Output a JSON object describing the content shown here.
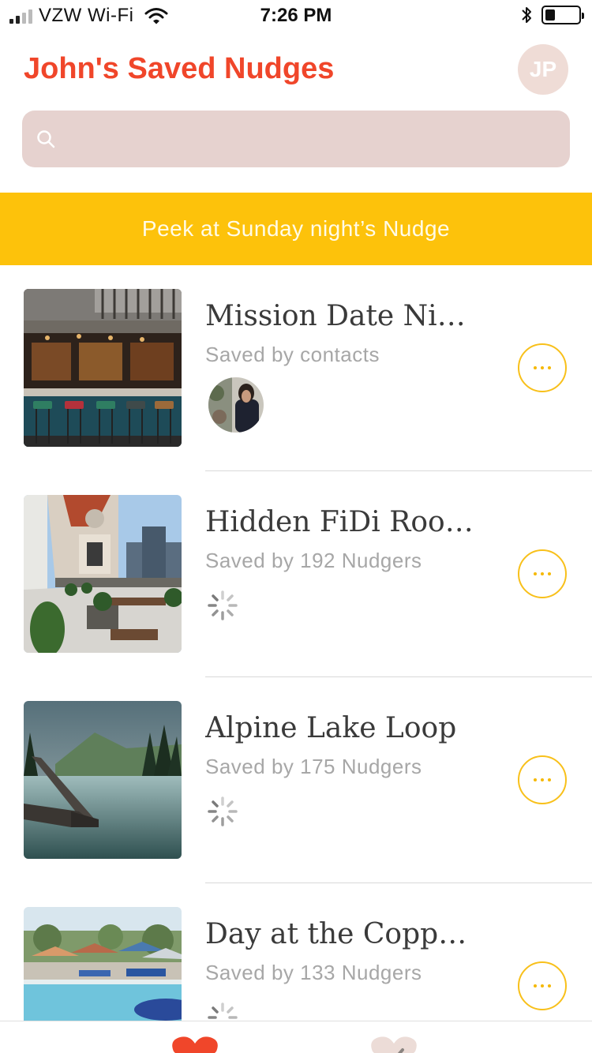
{
  "status_bar": {
    "carrier": "VZW Wi-Fi",
    "time": "7:26 PM",
    "battery_level": 0.3
  },
  "header": {
    "title": "John's Saved Nudges",
    "avatar_initials": "JP"
  },
  "search": {
    "value": "",
    "placeholder": ""
  },
  "banner": {
    "text": "Peek at Sunday night’s Nudge"
  },
  "nudges": [
    {
      "title": "Mission Date Night",
      "subtitle": "Saved by contacts",
      "image": "bar-interior"
    },
    {
      "title": "Hidden FiDi Rooftop",
      "subtitle": "Saved by 192 Nudgers",
      "image": "rooftop-terrace"
    },
    {
      "title": "Alpine Lake Loop",
      "subtitle": "Saved by 175 Nudgers",
      "image": "misty-lake"
    },
    {
      "title": "Day at the Coppola Winery",
      "subtitle": "Saved by 133 Nudgers",
      "image": "pool-umbrellas"
    }
  ],
  "icons": {
    "search": "search-icon",
    "more": "more-icon",
    "tab_saved": "heart-icon",
    "tab_done": "heart-check-icon"
  },
  "colors": {
    "accent_red": "#f0462a",
    "banner_yellow": "#fdc20b",
    "search_bg": "#e6d2cf",
    "avatar_bg": "#efdcd6",
    "more_border": "#f8c01a"
  }
}
